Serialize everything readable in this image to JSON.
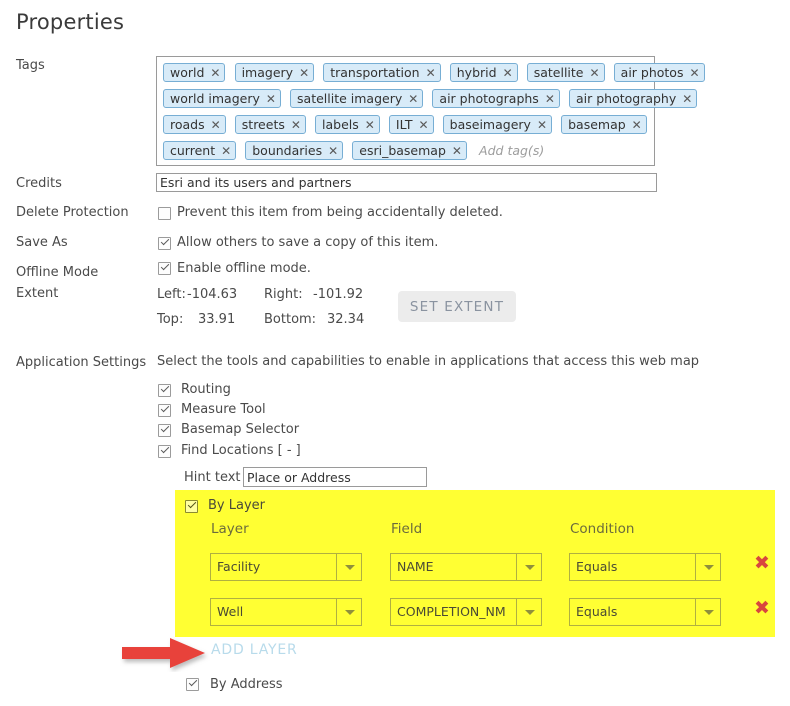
{
  "page_title": "Properties",
  "labels": {
    "tags": "Tags",
    "credits": "Credits",
    "delete_protection": "Delete Protection",
    "save_as": "Save As",
    "offline_mode": "Offline Mode",
    "extent": "Extent",
    "application_settings": "Application Settings"
  },
  "tags": {
    "rows": [
      [
        "world",
        "imagery",
        "transportation",
        "hybrid",
        "satellite",
        "air photos"
      ],
      [
        "world imagery",
        "satellite imagery",
        "air photographs",
        "air photography"
      ],
      [
        "roads",
        "streets",
        "labels",
        "ILT",
        "baseimagery",
        "basemap"
      ],
      [
        "current",
        "boundaries",
        "esri_basemap"
      ]
    ],
    "remove_icon": "✕",
    "placeholder": "Add tag(s)"
  },
  "credits": {
    "value": "Esri and its users and partners"
  },
  "delete_protection": {
    "checked": false,
    "label": "Prevent this item from being accidentally deleted."
  },
  "save_as": {
    "checked": true,
    "label": "Allow others to save a copy of this item."
  },
  "offline_mode": {
    "checked": true,
    "label": "Enable offline mode."
  },
  "extent": {
    "left_label": "Left:",
    "left_value": "-104.63",
    "right_label": "Right:",
    "right_value": "-101.92",
    "top_label": "Top:",
    "top_value": "33.91",
    "bottom_label": "Bottom:",
    "bottom_value": "32.34",
    "set_extent_button": "SET EXTENT"
  },
  "application_settings": {
    "description": "Select the tools and capabilities to enable in applications that access this web map",
    "tools": [
      {
        "label": "Routing",
        "checked": true
      },
      {
        "label": "Measure Tool",
        "checked": true
      },
      {
        "label": "Basemap Selector",
        "checked": true
      },
      {
        "label": "Find Locations [ - ]",
        "checked": true
      }
    ],
    "hint_text_label": "Hint text",
    "hint_text_value": "Place or Address"
  },
  "by_layer": {
    "label": "By Layer",
    "checked": true,
    "columns": [
      "Layer",
      "Field",
      "Condition"
    ],
    "rows": [
      {
        "layer": "Facility",
        "field": "NAME",
        "condition": "Equals",
        "delete_icon": "✖"
      },
      {
        "layer": "Well",
        "field": "COMPLETION_NM",
        "condition": "Equals",
        "delete_icon": "✖"
      }
    ],
    "highlight_color": "#ffff33"
  },
  "add_layer": {
    "label": "ADD LAYER"
  },
  "by_address": {
    "label": "By Address",
    "checked": true
  },
  "annotation": {
    "arrow_color": "#e8423a"
  }
}
